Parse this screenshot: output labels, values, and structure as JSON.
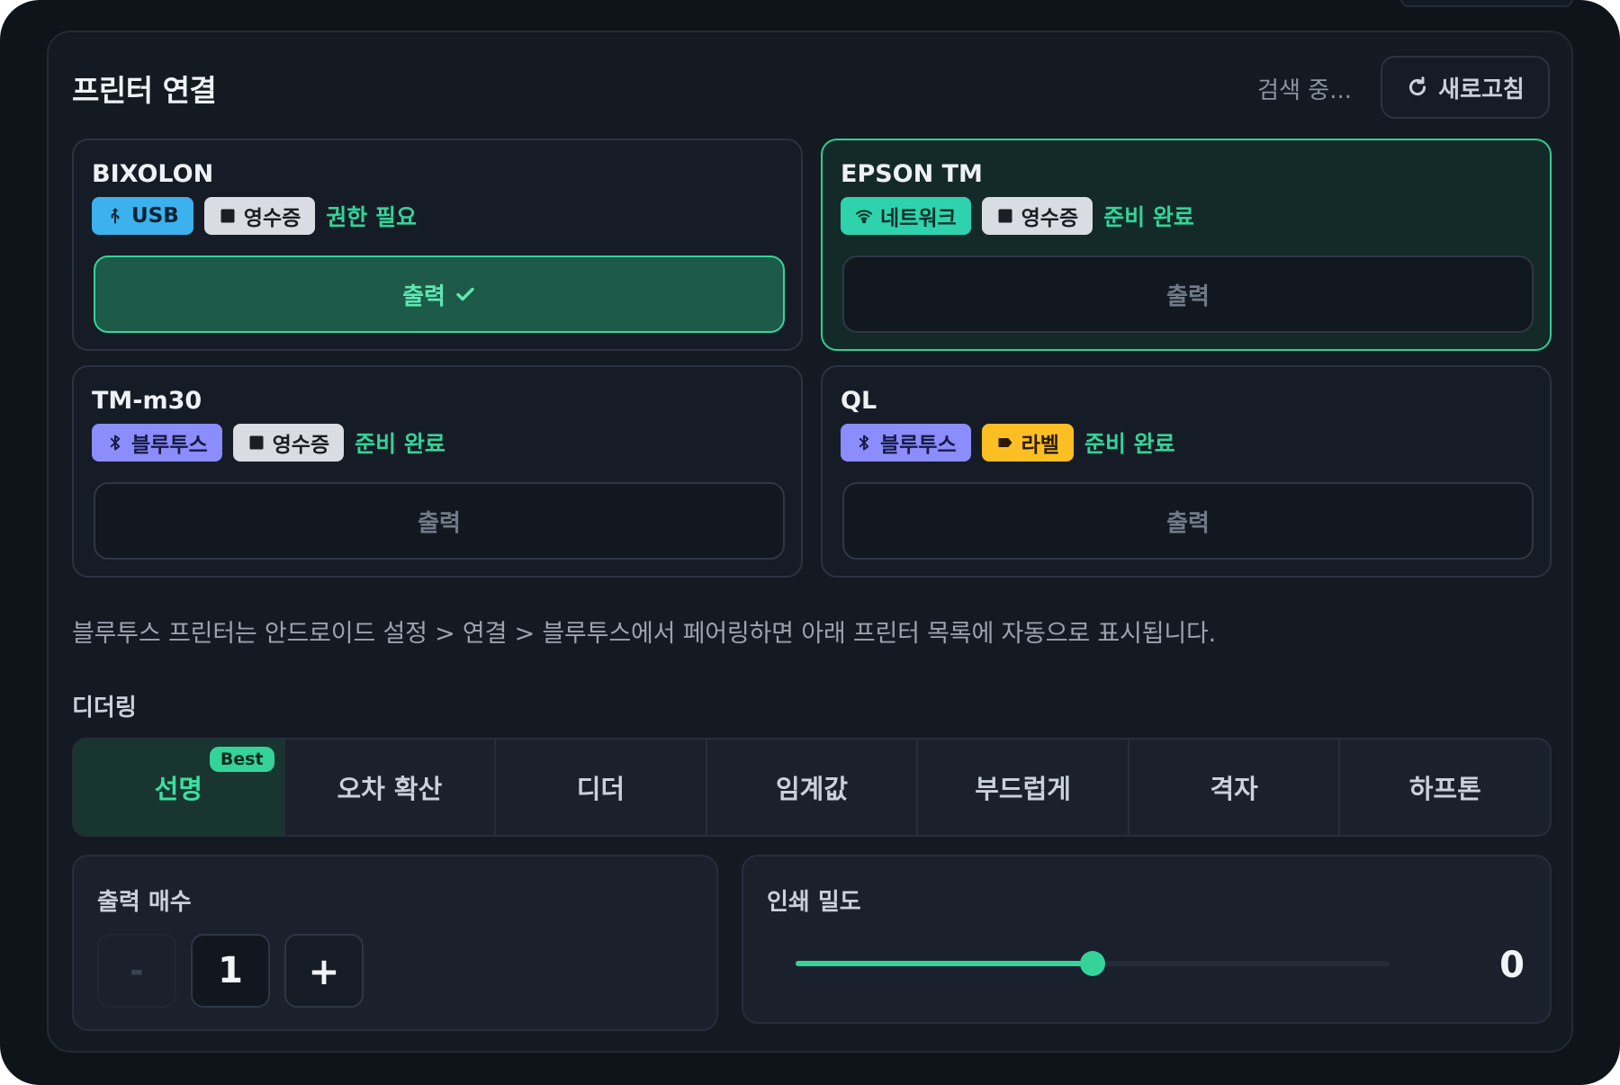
{
  "panel": {
    "title": "프린터 연결",
    "search_status": "검색 중...",
    "refresh_label": "새로고침"
  },
  "printers": [
    {
      "name": "BIXOLON",
      "connection": "USB",
      "connection_icon": "usb-icon",
      "type": "영수증",
      "status": "권한 필요",
      "print_label": "출력",
      "print_active": true
    },
    {
      "name": "EPSON TM",
      "connection": "네트워크",
      "connection_icon": "wifi-icon",
      "type": "영수증",
      "status": "준비 완료",
      "print_label": "출력",
      "selected": true
    },
    {
      "name": "TM-m30",
      "connection": "블루투스",
      "connection_icon": "bluetooth-icon",
      "type": "영수증",
      "status": "준비 완료",
      "print_label": "출력"
    },
    {
      "name": "QL",
      "connection": "블루투스",
      "connection_icon": "bluetooth-icon",
      "type": "라벨",
      "status": "준비 완료",
      "print_label": "출력"
    }
  ],
  "hint": "블루투스 프린터는 안드로이드 설정 > 연결 > 블루투스에서 페어링하면 아래 프린터 목록에 자동으로 표시됩니다.",
  "dithering": {
    "label": "디더링",
    "best_badge": "Best",
    "options": [
      "선명",
      "오차 확산",
      "디더",
      "임계값",
      "부드럽게",
      "격자",
      "하프톤"
    ],
    "selected": 0
  },
  "copies": {
    "label": "출력 매수",
    "minus_label": "-",
    "value": "1",
    "plus_label": "+"
  },
  "density": {
    "label": "인쇄 밀도",
    "value": "0",
    "slider_fraction": 0.5
  },
  "colors": {
    "accent": "#34d399",
    "usb": "#3cb1ee",
    "network": "#2ed3ad",
    "bluetooth": "#8a8dfb",
    "label_chip": "#fbbf24",
    "background": "#0f141b"
  }
}
